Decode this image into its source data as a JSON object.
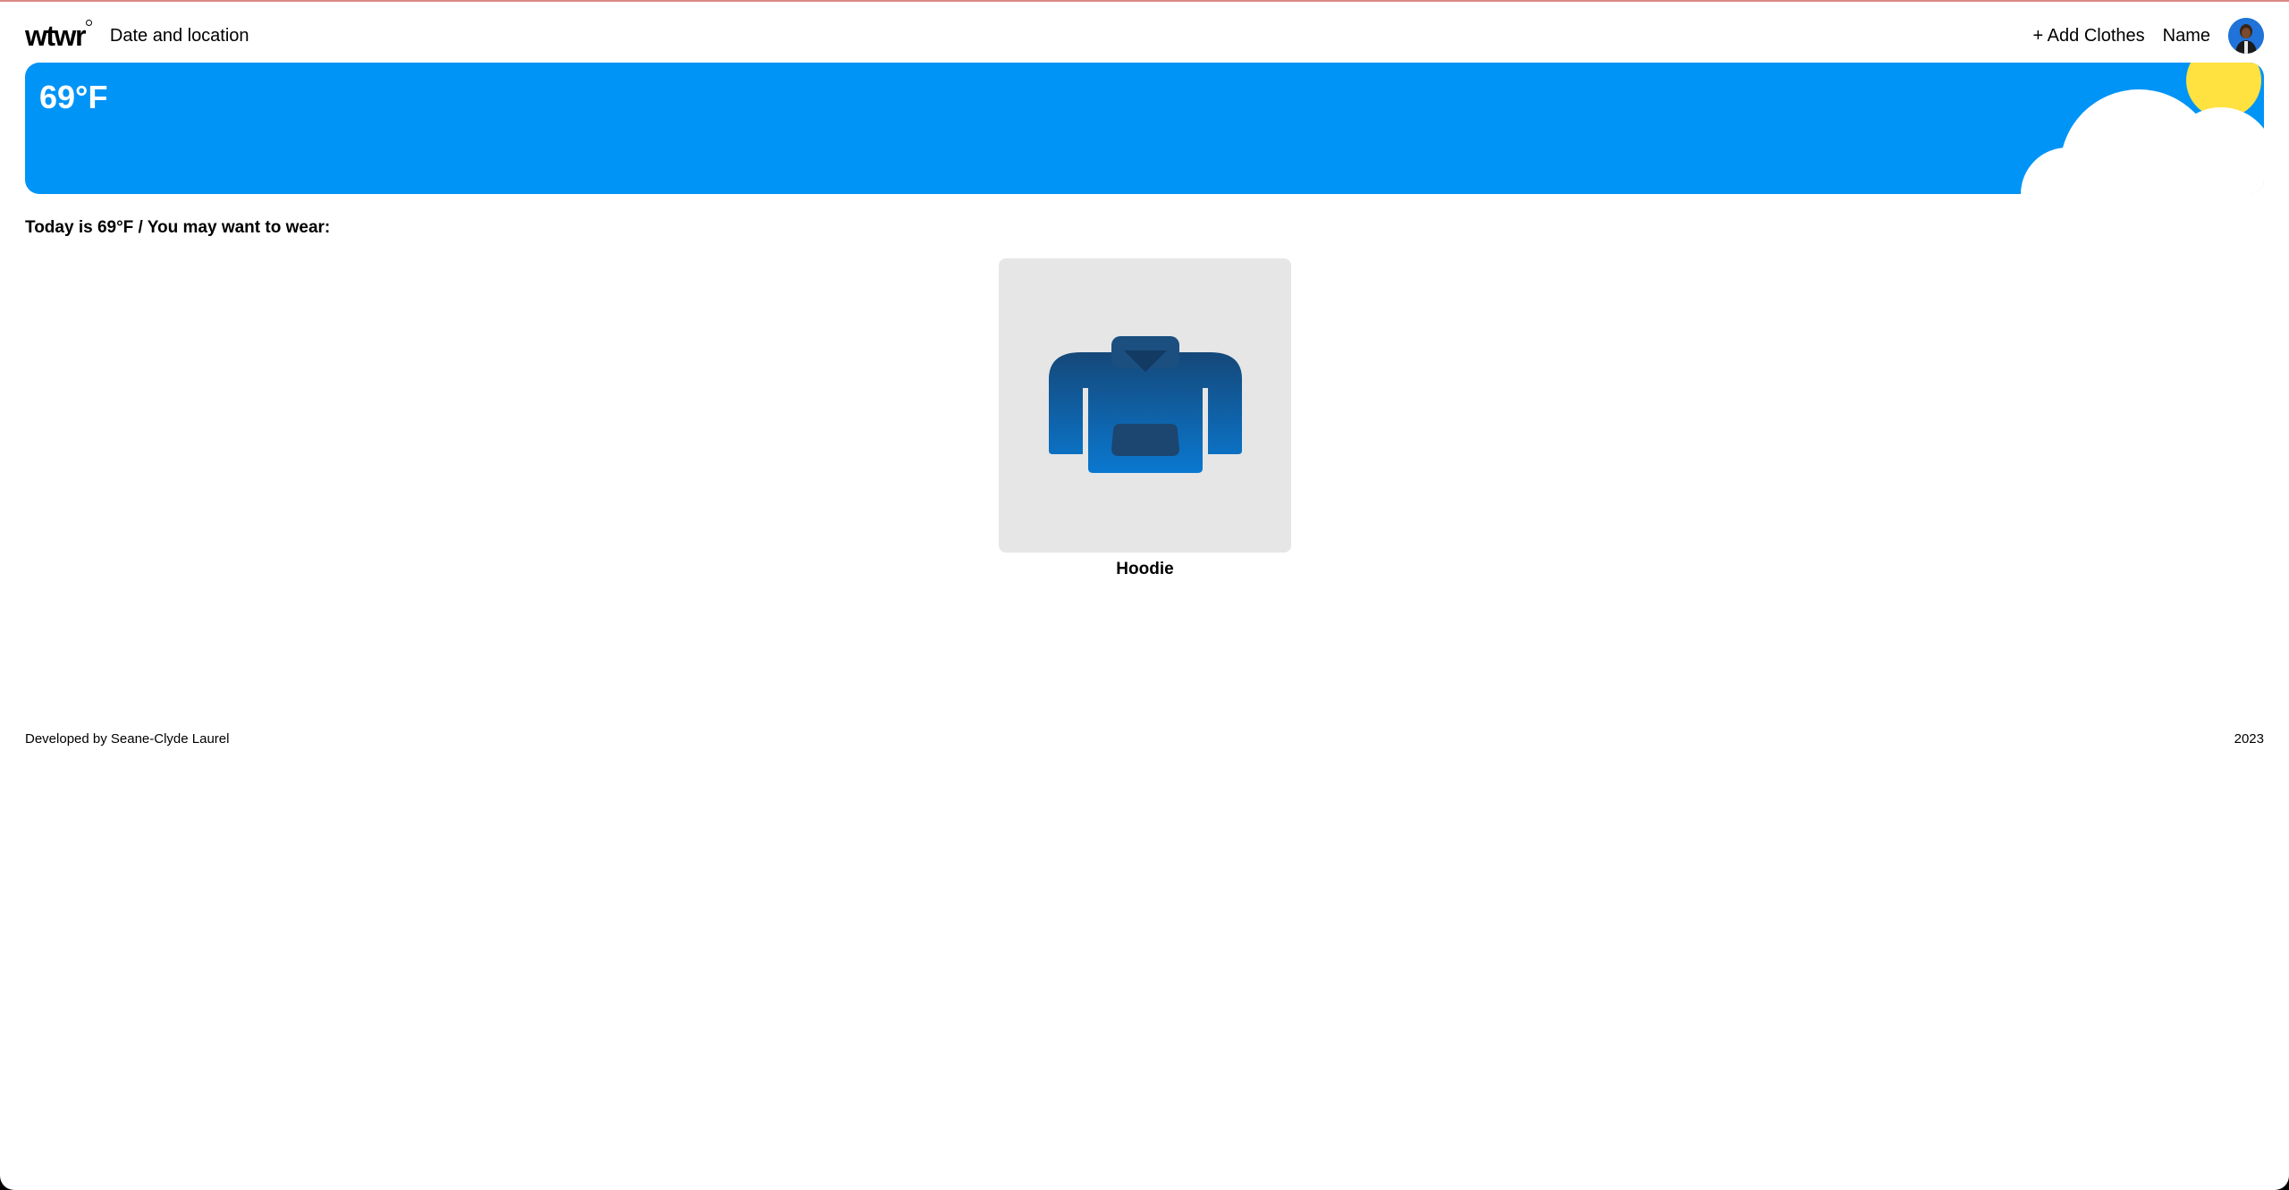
{
  "header": {
    "logo": "wtwr",
    "date_location": "Date and location",
    "add_clothes_label": "+ Add Clothes",
    "user_name": "Name",
    "avatar_icon": "user-avatar"
  },
  "weather": {
    "temperature": "69°F",
    "condition_icons": [
      "sun-icon",
      "cloud-icon"
    ],
    "colors": {
      "sky": "#0194f7",
      "sun": "#ffe23f",
      "cloud": "#ffffff"
    }
  },
  "main": {
    "recommendation": "Today is 69°F / You may want to wear:",
    "items": [
      {
        "name": "Hoodie",
        "icon": "hoodie-icon"
      }
    ]
  },
  "footer": {
    "developer": "Developed by Seane-Clyde Laurel",
    "year": "2023"
  }
}
